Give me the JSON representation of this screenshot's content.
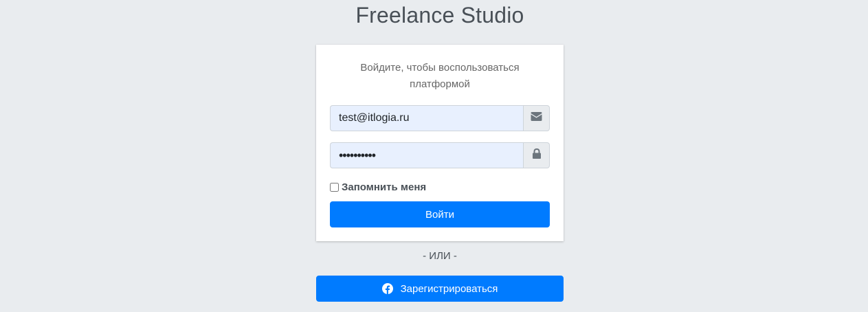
{
  "brand": {
    "title": "Freelance Studio"
  },
  "login_form": {
    "message": "Войдите, чтобы воспользоваться платформой",
    "email": {
      "value": "test@itlogia.ru",
      "icon": "envelope-icon"
    },
    "password": {
      "value": "••••••••••",
      "icon": "lock-icon"
    },
    "remember_label": "Запомнить меня",
    "remember_checked": false,
    "submit_label": "Войти"
  },
  "divider": {
    "text": "- ИЛИ -"
  },
  "register": {
    "label": "Зарегистрироваться",
    "icon": "facebook-icon"
  },
  "colors": {
    "background": "#e9ecef",
    "primary": "#007bff",
    "input_autofill": "#e8f0fe"
  }
}
